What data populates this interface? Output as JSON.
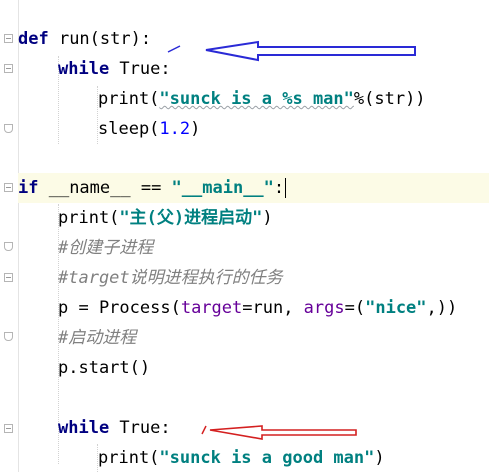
{
  "code": {
    "l1": {
      "kw": "def",
      "rest": " run(str):"
    },
    "l2": {
      "kw": "while",
      "rest": " True:"
    },
    "l3": {
      "fn": "print(",
      "str1": "\"sunck is a %s man\"",
      "rest": "%(str))"
    },
    "l4": {
      "fn": "sleep(",
      "num": "1.2",
      "close": ")"
    },
    "l5": {
      "kw": "if",
      "mid": " __name__ == ",
      "str": "\"__main__\"",
      "colon": ":"
    },
    "l6": {
      "fn": "print(",
      "str": "\"主(父)进程启动\"",
      "close": ")"
    },
    "l7": {
      "comment": "#创建子进程"
    },
    "l8": {
      "comment": "#target说明进程执行的任务"
    },
    "l9": {
      "pre": "p = Process(",
      "p1": "target",
      "mid": "=run, ",
      "p2": "args",
      "eq": "=(",
      "str": "\"nice\"",
      "close": ",))"
    },
    "l10": {
      "comment": "#启动进程"
    },
    "l11": {
      "text": "p.start()"
    },
    "l12": {
      "kw": "while",
      "rest": " True:"
    },
    "l13": {
      "fn": "print(",
      "str": "\"sunck is a good man\"",
      "close": ")"
    }
  },
  "colors": {
    "keyword": "#000080",
    "string": "#008080",
    "number": "#0000ff",
    "comment": "#808080",
    "param": "#660099",
    "annotation_arrow_1": "#2a2ad6",
    "annotation_arrow_2": "#d42020"
  }
}
